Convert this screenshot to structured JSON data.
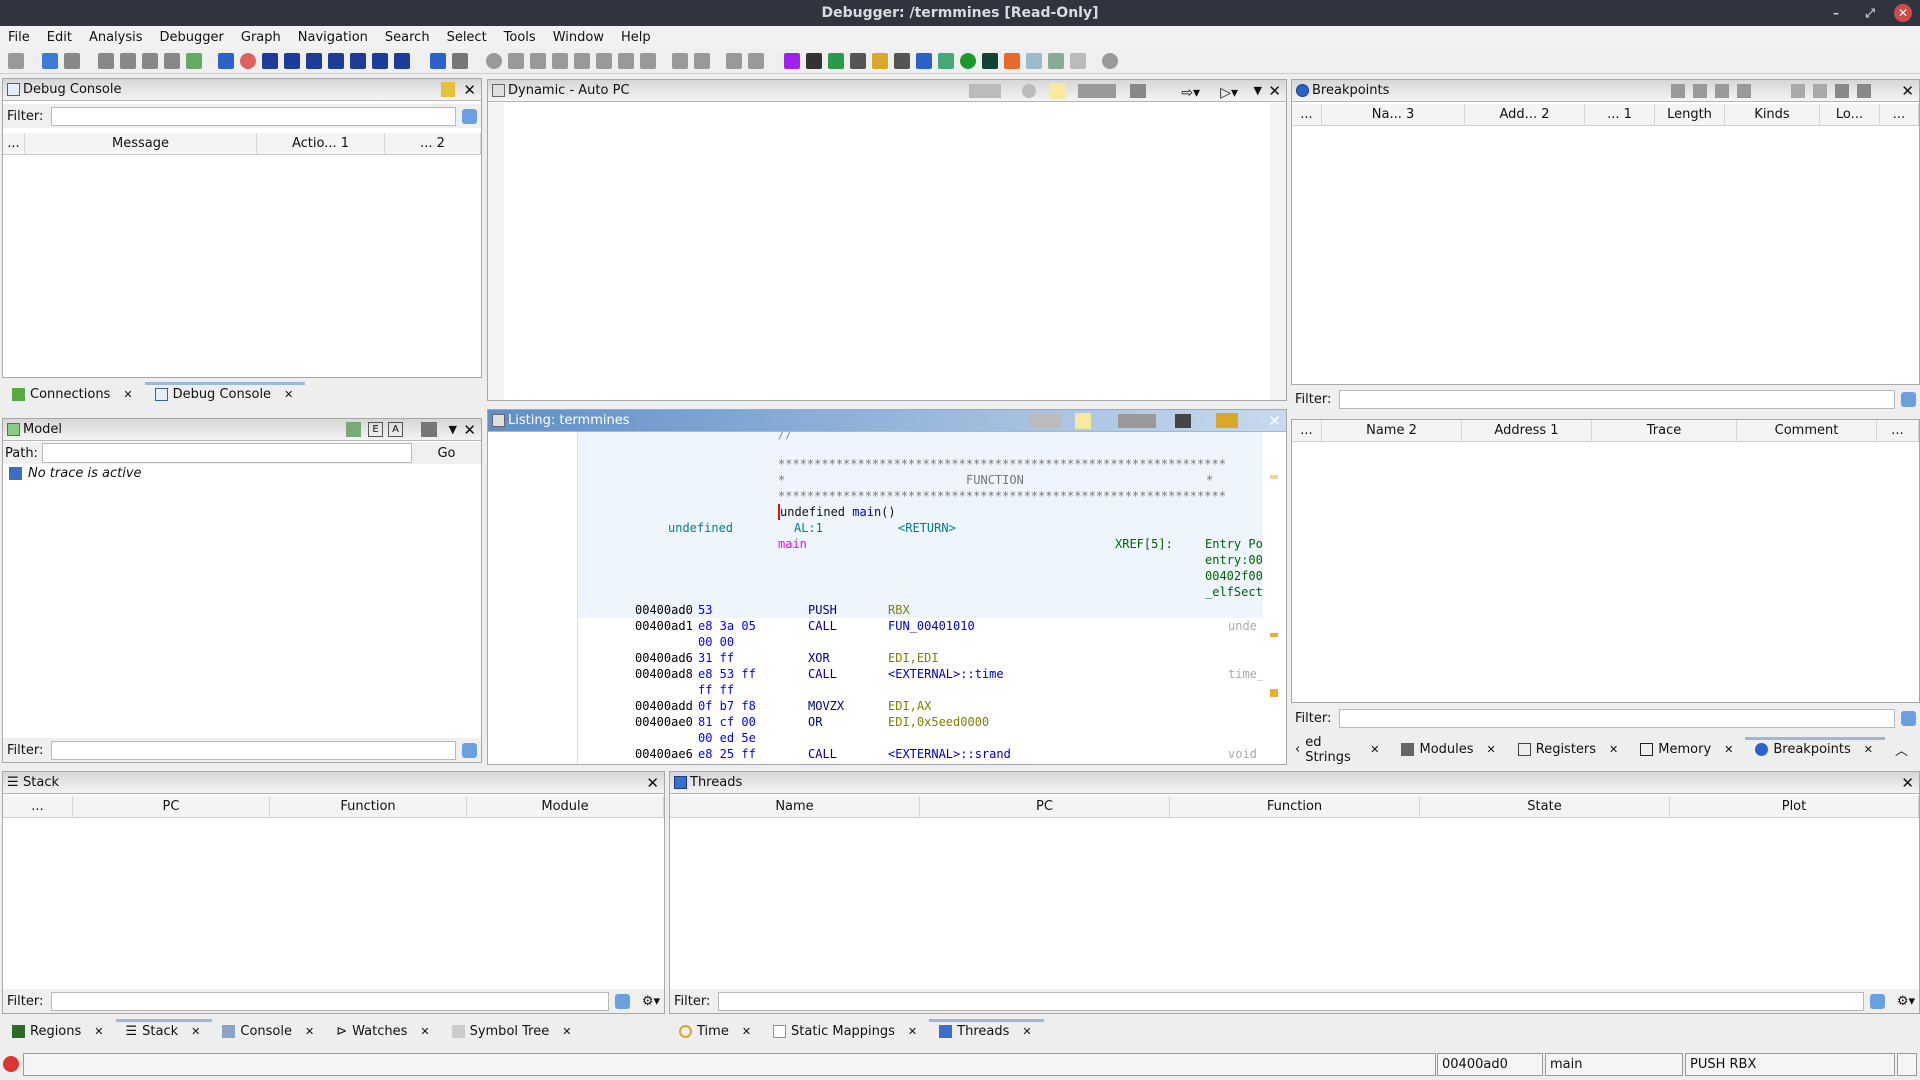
{
  "window": {
    "title": "Debugger: /termmines [Read-Only]"
  },
  "menu": [
    "File",
    "Edit",
    "Analysis",
    "Debugger",
    "Graph",
    "Navigation",
    "Search",
    "Select",
    "Tools",
    "Window",
    "Help"
  ],
  "debug_console": {
    "title": "Debug Console",
    "filter_label": "Filter:",
    "columns": [
      "...",
      "Message",
      "Actio... 1",
      "... 2"
    ]
  },
  "left_tabs": [
    "Connections",
    "Debug Console"
  ],
  "model": {
    "title": "Model",
    "path_label": "Path:",
    "go": "Go",
    "message": "No trace is active",
    "filter_label": "Filter:",
    "buttons": [
      "E",
      "A"
    ]
  },
  "dynamic": {
    "title": "Dynamic - Auto PC"
  },
  "listing": {
    "title": "Listing:  termmines",
    "stars": "**************************************************************",
    "function_banner_left": "*",
    "function_banner": "FUNCTION",
    "function_banner_right": "*",
    "signature_ret": "undefined",
    "signature_name": "main",
    "signature_args": "()",
    "ret_type": "undefined",
    "ret_storage": "AL:1",
    "ret_name": "<RETURN>",
    "label": "main",
    "xref": "XREF[5]:",
    "xrefs": [
      "Entry Po",
      "entry:00",
      "00402f00",
      "_elfSect"
    ],
    "instructions": [
      {
        "addr": "00400ad0",
        "bytes": "53",
        "mnem": "PUSH",
        "ops": "RBX",
        "cmt": ""
      },
      {
        "addr": "00400ad1",
        "bytes": "e8 3a 05",
        "mnem": "CALL",
        "ops": "FUN_00401010",
        "cmt": "unde"
      },
      {
        "addr": "",
        "bytes": "00 00",
        "mnem": "",
        "ops": "",
        "cmt": ""
      },
      {
        "addr": "00400ad6",
        "bytes": "31 ff",
        "mnem": "XOR",
        "ops": "EDI,EDI",
        "cmt": ""
      },
      {
        "addr": "00400ad8",
        "bytes": "e8 53 ff",
        "mnem": "CALL",
        "ops": "<EXTERNAL>::time",
        "cmt": "time_"
      },
      {
        "addr": "",
        "bytes": "ff ff",
        "mnem": "",
        "ops": "",
        "cmt": ""
      },
      {
        "addr": "00400add",
        "bytes": "0f b7 f8",
        "mnem": "MOVZX",
        "ops": "EDI,AX",
        "cmt": ""
      },
      {
        "addr": "00400ae0",
        "bytes": "81 cf 00",
        "mnem": "OR",
        "ops": "EDI,0x5eed0000",
        "cmt": ""
      },
      {
        "addr": "",
        "bytes": "00 ed 5e",
        "mnem": "",
        "ops": "",
        "cmt": ""
      },
      {
        "addr": "00400ae6",
        "bytes": "e8 25 ff",
        "mnem": "CALL",
        "ops": "<EXTERNAL>::srand",
        "cmt": "void"
      }
    ]
  },
  "breakpoints": {
    "title": "Breakpoints",
    "columns": [
      "...",
      "Na... 3",
      "Add... 2",
      "... 1",
      "Length",
      "Kinds",
      "Lo...",
      "..."
    ],
    "filter_label": "Filter:",
    "loc_columns": [
      "...",
      "Name 2",
      "Address 1",
      "Trace",
      "Comment",
      "..."
    ]
  },
  "right_tabs": [
    "ed Strings",
    "Modules",
    "Registers",
    "Memory",
    "Breakpoints"
  ],
  "stack": {
    "title": "Stack",
    "columns": [
      "... ",
      "PC",
      "Function",
      "Module"
    ],
    "filter_label": "Filter:"
  },
  "threads": {
    "title": "Threads",
    "columns": [
      "Name",
      "PC",
      "Function",
      "State",
      "Plot"
    ],
    "filter_label": "Filter:"
  },
  "bottom_tabs_left": [
    "Regions",
    "Stack",
    "Console",
    "Watches",
    "Symbol Tree"
  ],
  "bottom_tabs_right": [
    "Time",
    "Static Mappings",
    "Threads"
  ],
  "status": {
    "address": "00400ad0",
    "function": "main",
    "instruction": "PUSH RBX"
  },
  "colors": {
    "accent": "#5f8fc7",
    "listing_bg": "#eef5fd",
    "address": "#000000",
    "bytes": "#0000ff",
    "mnemonic": "#000080",
    "register": "#808000",
    "label": "#ff00ff",
    "type": "#008080",
    "xref": "#006400"
  }
}
